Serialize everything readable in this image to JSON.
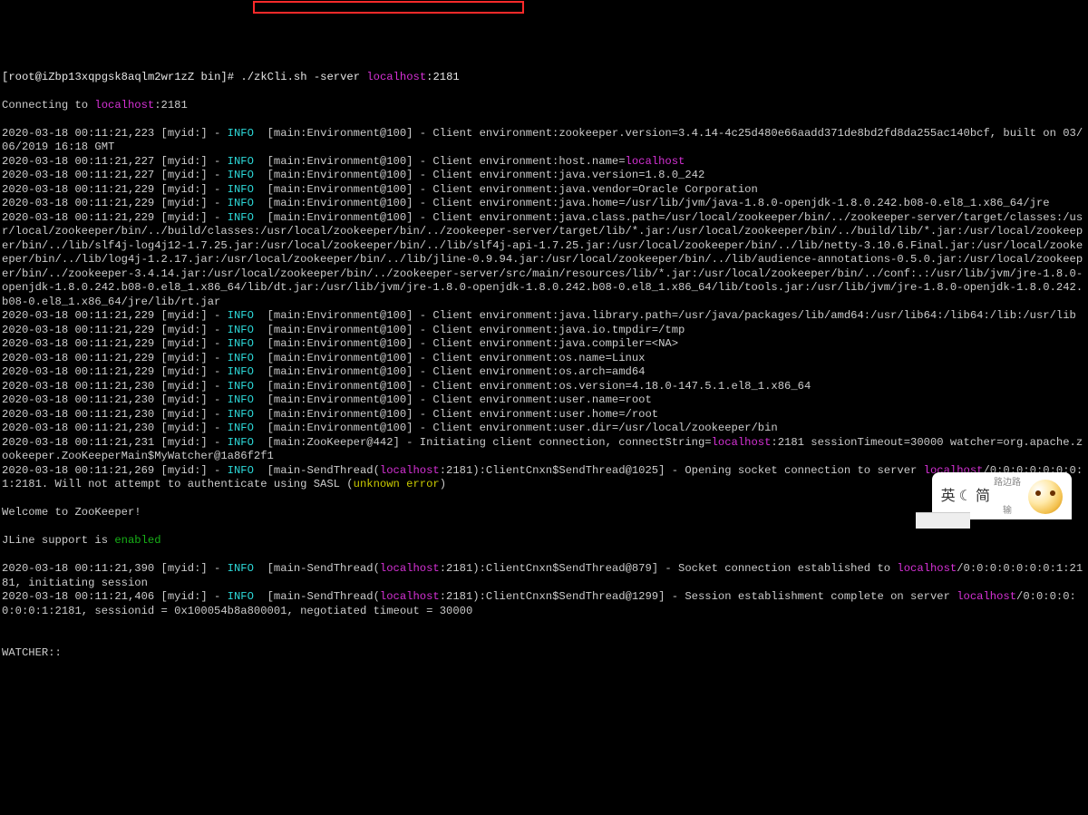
{
  "prompt": {
    "user": "root",
    "host": "iZbp13xqpgsk8aqlm2wr1zZ",
    "dir": "bin",
    "cmd": "./zkCli.sh -server ",
    "target_host": "localhost",
    "target_port": ":2181"
  },
  "connecting": {
    "prefix": "Connecting to ",
    "host": "localhost",
    "port": ":2181"
  },
  "lines": [
    {
      "ts": "2020-03-18 00:11:21,223",
      "rest": "  [main:Environment@100] - Client environment:zookeeper.version=3.4.14-4c25d480e66aadd371de8bd2fd8da255ac140bcf, built on 03/06/2019 16:18 GMT"
    },
    {
      "ts": "2020-03-18 00:11:21,227",
      "rest_parts": [
        {
          "t": "  [main:Environment@100] - Client environment:host.name="
        },
        {
          "t": "localhost",
          "c": "magenta"
        }
      ]
    },
    {
      "ts": "2020-03-18 00:11:21,227",
      "rest": "  [main:Environment@100] - Client environment:java.version=1.8.0_242"
    },
    {
      "ts": "2020-03-18 00:11:21,229",
      "rest": "  [main:Environment@100] - Client environment:java.vendor=Oracle Corporation"
    },
    {
      "ts": "2020-03-18 00:11:21,229",
      "rest": "  [main:Environment@100] - Client environment:java.home=/usr/lib/jvm/java-1.8.0-openjdk-1.8.0.242.b08-0.el8_1.x86_64/jre"
    },
    {
      "ts": "2020-03-18 00:11:21,229",
      "rest": "  [main:Environment@100] - Client environment:java.class.path=/usr/local/zookeeper/bin/../zookeeper-server/target/classes:/usr/local/zookeeper/bin/../build/classes:/usr/local/zookeeper/bin/../zookeeper-server/target/lib/*.jar:/usr/local/zookeeper/bin/../build/lib/*.jar:/usr/local/zookeeper/bin/../lib/slf4j-log4j12-1.7.25.jar:/usr/local/zookeeper/bin/../lib/slf4j-api-1.7.25.jar:/usr/local/zookeeper/bin/../lib/netty-3.10.6.Final.jar:/usr/local/zookeeper/bin/../lib/log4j-1.2.17.jar:/usr/local/zookeeper/bin/../lib/jline-0.9.94.jar:/usr/local/zookeeper/bin/../lib/audience-annotations-0.5.0.jar:/usr/local/zookeeper/bin/../zookeeper-3.4.14.jar:/usr/local/zookeeper/bin/../zookeeper-server/src/main/resources/lib/*.jar:/usr/local/zookeeper/bin/../conf:.:/usr/lib/jvm/jre-1.8.0-openjdk-1.8.0.242.b08-0.el8_1.x86_64/lib/dt.jar:/usr/lib/jvm/jre-1.8.0-openjdk-1.8.0.242.b08-0.el8_1.x86_64/lib/tools.jar:/usr/lib/jvm/jre-1.8.0-openjdk-1.8.0.242.b08-0.el8_1.x86_64/jre/lib/rt.jar"
    },
    {
      "ts": "2020-03-18 00:11:21,229",
      "rest": "  [main:Environment@100] - Client environment:java.library.path=/usr/java/packages/lib/amd64:/usr/lib64:/lib64:/lib:/usr/lib"
    },
    {
      "ts": "2020-03-18 00:11:21,229",
      "rest": "  [main:Environment@100] - Client environment:java.io.tmpdir=/tmp"
    },
    {
      "ts": "2020-03-18 00:11:21,229",
      "rest": "  [main:Environment@100] - Client environment:java.compiler=<NA>"
    },
    {
      "ts": "2020-03-18 00:11:21,229",
      "rest": "  [main:Environment@100] - Client environment:os.name=Linux"
    },
    {
      "ts": "2020-03-18 00:11:21,229",
      "rest": "  [main:Environment@100] - Client environment:os.arch=amd64"
    },
    {
      "ts": "2020-03-18 00:11:21,230",
      "rest": "  [main:Environment@100] - Client environment:os.version=4.18.0-147.5.1.el8_1.x86_64"
    },
    {
      "ts": "2020-03-18 00:11:21,230",
      "rest": "  [main:Environment@100] - Client environment:user.name=root"
    },
    {
      "ts": "2020-03-18 00:11:21,230",
      "rest": "  [main:Environment@100] - Client environment:user.home=/root"
    },
    {
      "ts": "2020-03-18 00:11:21,230",
      "rest": "  [main:Environment@100] - Client environment:user.dir=/usr/local/zookeeper/bin"
    },
    {
      "ts": "2020-03-18 00:11:21,231",
      "rest_parts": [
        {
          "t": "  [main:ZooKeeper@442] - Initiating client connection, connectString="
        },
        {
          "t": "localhost",
          "c": "magenta"
        },
        {
          "t": ":2181 sessionTimeout=30000 watcher=org.apache.zookeeper.ZooKeeperMain$MyWatcher@1a86f2f1"
        }
      ]
    },
    {
      "ts": "2020-03-18 00:11:21,269",
      "rest_parts": [
        {
          "t": "  [main-SendThread("
        },
        {
          "t": "localhost",
          "c": "magenta"
        },
        {
          "t": ":2181):ClientCnxn$SendThread@1025] - Opening socket connection to server "
        },
        {
          "t": "localhost",
          "c": "magenta"
        },
        {
          "t": "/0:0:0:0:0:0:0:1:2181. Will not attempt to authenticate using SASL ("
        },
        {
          "t": "unknown error",
          "c": "yellow"
        },
        {
          "t": ")"
        }
      ]
    }
  ],
  "welcome": "Welcome to ZooKeeper!",
  "jline": {
    "pre": "JLine support is ",
    "val": "enabled"
  },
  "tail": [
    {
      "ts": "2020-03-18 00:11:21,390",
      "rest_parts": [
        {
          "t": "  [main-SendThread("
        },
        {
          "t": "localhost",
          "c": "magenta"
        },
        {
          "t": ":2181):ClientCnxn$SendThread@879] - Socket connection established to "
        },
        {
          "t": "localhost",
          "c": "magenta"
        },
        {
          "t": "/0:0:0:0:0:0:0:1:2181, initiating session"
        }
      ]
    },
    {
      "ts": "2020-03-18 00:11:21,406",
      "rest_parts": [
        {
          "t": "  [main-SendThread("
        },
        {
          "t": "localhost",
          "c": "magenta"
        },
        {
          "t": ":2181):ClientCnxn$SendThread@1299] - Session establishment complete on server "
        },
        {
          "t": "localhost",
          "c": "magenta"
        },
        {
          "t": "/0:0:0:0:0:0:0:1:2181, sessionid = 0x100054b8a800001, negotiated timeout = 30000"
        }
      ]
    }
  ],
  "watcher_label": "WATCHER::",
  "myid_label": " [myid:] - ",
  "info_label": "INFO",
  "ime": {
    "a": "英",
    "b": "简",
    "c": "路边路",
    "d": "输"
  }
}
